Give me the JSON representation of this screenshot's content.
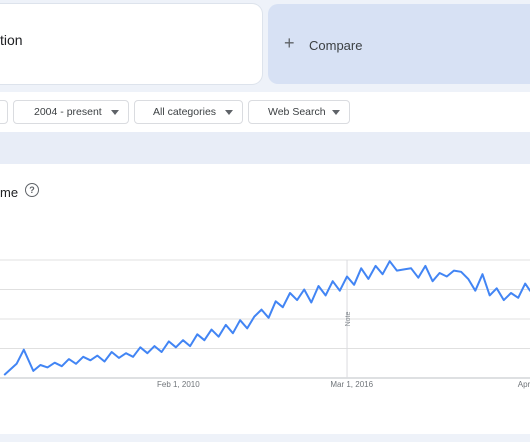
{
  "search_term": {
    "value": "tion"
  },
  "compare": {
    "plus_glyph": "+",
    "label": "Compare"
  },
  "filters": {
    "time_range": "2004 - present",
    "category": "All categories",
    "property": "Web Search"
  },
  "chart": {
    "title": "me",
    "help_glyph": "?",
    "note_label": "Note"
  },
  "chart_data": {
    "type": "line",
    "title": "",
    "xlabel": "",
    "ylabel": "",
    "x_tick_labels": [
      "Feb 1, 2010",
      "Mar 1, 2016",
      "Apr"
    ],
    "x_ticks": [
      "2010-02-01",
      "2016-03-01",
      "2022-04-01"
    ],
    "xlim": [
      "2003-11-01",
      "2022-06-01"
    ],
    "ylim": [
      0,
      100
    ],
    "grid": true,
    "line_color": "#4285f4",
    "annotations": [
      {
        "x": "2016-01-01",
        "label": "Note"
      }
    ],
    "series": [
      {
        "x": [
          "2004-01",
          "2004-06",
          "2004-09",
          "2005-01",
          "2005-04",
          "2005-07",
          "2005-10",
          "2006-01",
          "2006-04",
          "2006-07",
          "2006-10",
          "2007-01",
          "2007-04",
          "2007-07",
          "2007-10",
          "2008-01",
          "2008-04",
          "2008-07",
          "2008-10",
          "2009-01",
          "2009-04",
          "2009-07",
          "2009-10",
          "2010-01",
          "2010-04",
          "2010-07",
          "2010-10",
          "2011-01",
          "2011-04",
          "2011-07",
          "2011-10",
          "2012-01",
          "2012-04",
          "2012-07",
          "2012-10",
          "2013-01",
          "2013-04",
          "2013-07",
          "2013-10",
          "2014-01",
          "2014-04",
          "2014-07",
          "2014-10",
          "2015-01",
          "2015-04",
          "2015-07",
          "2015-10",
          "2016-01",
          "2016-04",
          "2016-07",
          "2016-10",
          "2017-01",
          "2017-04",
          "2017-07",
          "2017-10",
          "2018-01",
          "2018-04",
          "2018-07",
          "2018-10",
          "2019-01",
          "2019-04",
          "2019-07",
          "2019-10",
          "2020-01",
          "2020-04",
          "2020-07",
          "2020-10",
          "2021-01",
          "2021-04",
          "2021-07",
          "2021-10",
          "2022-01",
          "2022-04",
          "2022-06"
        ],
        "values": [
          3,
          12,
          24,
          6,
          11,
          9,
          13,
          10,
          16,
          12,
          18,
          15,
          19,
          14,
          22,
          17,
          21,
          18,
          26,
          21,
          27,
          22,
          31,
          26,
          32,
          27,
          37,
          32,
          41,
          35,
          45,
          38,
          49,
          42,
          52,
          58,
          51,
          65,
          60,
          72,
          66,
          75,
          64,
          78,
          70,
          82,
          74,
          86,
          79,
          93,
          84,
          95,
          88,
          99,
          91,
          92,
          93,
          85,
          95,
          82,
          89,
          86,
          91,
          90,
          84,
          74,
          88,
          70,
          76,
          66,
          72,
          68,
          80,
          74
        ]
      }
    ]
  }
}
